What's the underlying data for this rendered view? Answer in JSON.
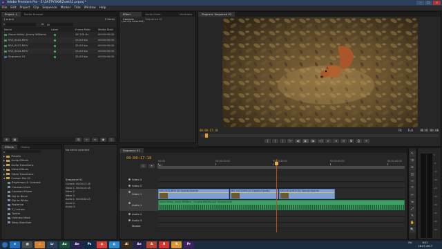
{
  "window": {
    "title": "Adobe Premiere Pro - E:\\ЗАГРУЗКИ\\Zveki\\1.prproj *",
    "controls": [
      "–",
      "□",
      "×"
    ]
  },
  "menu": [
    "File",
    "Edit",
    "Project",
    "Clip",
    "Sequence",
    "Marker",
    "Title",
    "Window",
    "Help"
  ],
  "project": {
    "tabs": [
      "Project: 1",
      "Media Browser"
    ],
    "filename": "1.prproj",
    "item_count": "5 Items",
    "search_label": "In:",
    "search_value": "All",
    "columns": [
      "Name",
      "Label",
      "Frame Rate",
      "Media Start"
    ],
    "items": [
      {
        "name": "Aaron Kelley, Jimmy Williams",
        "label_color": "#3fa34d",
        "rate": "44 100 Hz",
        "start": "00:00:00:00",
        "kind": "audio"
      },
      {
        "name": "MVI_0422.MOV",
        "label_color": "#3fa34d",
        "rate": "25,00 fps",
        "start": "00:00:00:00",
        "kind": "video"
      },
      {
        "name": "MVI_0423.MOV",
        "label_color": "#3fa34d",
        "rate": "25,00 fps",
        "start": "00:00:00:00",
        "kind": "video"
      },
      {
        "name": "MVI_0424.MOV",
        "label_color": "#3fa34d",
        "rate": "25,00 fps",
        "start": "00:00:00:00",
        "kind": "video"
      },
      {
        "name": "Sequence 01",
        "label_color": "#3fa34d",
        "rate": "25,00 fps",
        "start": "00:00:00:00",
        "kind": "sequence"
      }
    ]
  },
  "effect_controls": {
    "tabs": [
      "Effect Controls",
      "Audio Mixer: Sequence 01",
      "Metadata"
    ],
    "placeholder": "(no clip selected)"
  },
  "program": {
    "tab": "Program: Sequence 01",
    "timecode": "00:00:17:18",
    "fit": "Fit",
    "full": "Full",
    "duration": "00:01:06:00",
    "controls": [
      "{",
      "}",
      "|",
      "{←",
      "◀|",
      "▶",
      "|▶",
      "→}",
      "⇤",
      "⇥",
      "⊡",
      "⧉",
      "⎙",
      "+"
    ]
  },
  "effects": {
    "tabs": [
      "Effects",
      "History"
    ],
    "items": [
      {
        "label": "Presets",
        "level": 0,
        "icon": "folder",
        "open": false
      },
      {
        "label": "Audio Effects",
        "level": 0,
        "icon": "folder",
        "open": false
      },
      {
        "label": "Audio Transitions",
        "level": 0,
        "icon": "folder",
        "open": false
      },
      {
        "label": "Video Effects",
        "level": 0,
        "icon": "folder",
        "open": false
      },
      {
        "label": "Video Transitions",
        "level": 0,
        "icon": "folder",
        "open": false
      },
      {
        "label": "Custom Bin 01",
        "level": 0,
        "icon": "folder",
        "open": true
      },
      {
        "label": "Brightness & Contrast",
        "level": 1,
        "icon": "fx"
      },
      {
        "label": "Constant Gain",
        "level": 1,
        "icon": "fx"
      },
      {
        "label": "Constant Power",
        "level": 1,
        "icon": "fx"
      },
      {
        "label": "Dip to Black",
        "level": 1,
        "icon": "fx"
      },
      {
        "label": "Dip to White",
        "level": 1,
        "icon": "fx"
      },
      {
        "label": "Posterize",
        "level": 1,
        "icon": "fx"
      },
      {
        "label": "T_Custom",
        "level": 1,
        "icon": "fx"
      },
      {
        "label": "Twirler",
        "level": 1,
        "icon": "fx"
      },
      {
        "label": "Unsharp Mask",
        "level": 1,
        "icon": "fx"
      },
      {
        "label": "Warp Stabilizer",
        "level": 1,
        "icon": "fx"
      }
    ]
  },
  "info": {
    "no_selection": "No items selected",
    "sequence_label": "Sequence 01",
    "lines": [
      "Current: 00:00:17:18",
      "Video 1: 00:00:15:18",
      "Video 2:",
      "Video 3:",
      "Audio 1: 00:00:02:15",
      "Audio 2:",
      "Audio 3:"
    ]
  },
  "timeline": {
    "tab": "Sequence 01",
    "timecode": "00:00:17:18",
    "ruler_labels": [
      "00:00",
      "00:00:15:00",
      "00:00:30:00",
      "00:00:45:00",
      "00:01:00:00"
    ],
    "playhead_fraction": 0.48,
    "video_tracks": [
      "Video 3",
      "Video 2",
      "Video 1"
    ],
    "audio_tracks": [
      "Audio 1",
      "Audio 2",
      "Audio 3"
    ],
    "master": "Master",
    "video_clips": [
      {
        "label": "MVI_0422.MOV [V] Opacity:Opacity",
        "start": 0.0,
        "end": 0.29
      },
      {
        "label": "MVI_0423.MOV [V] Opacity:Opacity",
        "start": 0.29,
        "end": 0.49
      },
      {
        "label": "MVI_0424.MOV [V] Opacity:Opacity",
        "start": 0.49,
        "end": 0.72
      }
    ],
    "audio_clip": {
      "label": "Aaron Kelley, Jimmy Williams - Surging Wheels.mp3 Volume:Level",
      "start": 0.0,
      "end": 1.0
    },
    "tools": [
      "↖",
      "⇉",
      "⇹",
      "◫",
      "⇿",
      "⤧",
      "✂",
      "⇋",
      "⤢",
      "✎",
      "✋",
      "🔍"
    ]
  },
  "audio_meter": {
    "scale": [
      "0",
      "-6",
      "-12",
      "-18",
      "-24",
      "-30",
      "-36",
      "-42",
      "-48",
      "-54"
    ]
  },
  "taskbar": {
    "apps": [
      {
        "label": "e",
        "color": "#1e6fc4"
      },
      {
        "label": "▦",
        "color": "#4a4a4a"
      },
      {
        "label": "♪",
        "color": "#d4802a"
      },
      {
        "label": "Lr",
        "color": "#2a3f55"
      },
      {
        "label": "Au",
        "color": "#174e3a"
      },
      {
        "label": "Ae",
        "color": "#2a1e52"
      },
      {
        "label": "Ps",
        "color": "#0d2a4a"
      },
      {
        "label": "◉",
        "color": "#d94032"
      },
      {
        "label": "◐",
        "color": "#2b8ad4"
      },
      {
        "label": "Ai",
        "color": "#3b2a10"
      },
      {
        "label": "Ae",
        "color": "#2a1e52"
      },
      {
        "label": "A",
        "color": "#b8452e"
      },
      {
        "label": "Я",
        "color": "#d9342b"
      },
      {
        "label": "Я",
        "color": "#e0962a"
      },
      {
        "label": "Pr",
        "color": "#3d1f66"
      }
    ],
    "lang": "RU",
    "time": "6:51",
    "date": "26.07.2017"
  }
}
